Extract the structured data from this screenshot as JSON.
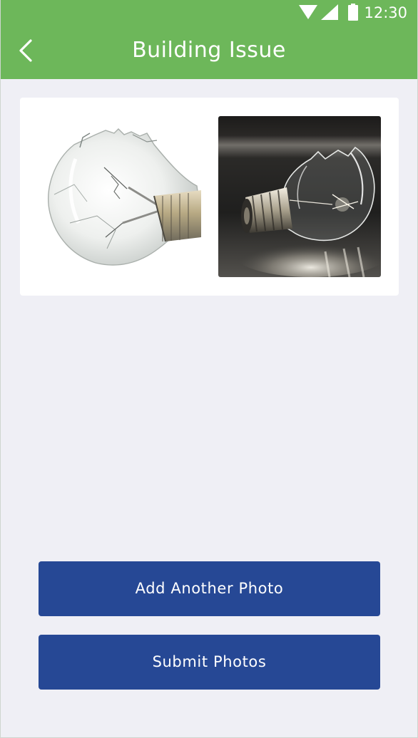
{
  "status_bar": {
    "time": "12:30",
    "icons": [
      "wifi-icon",
      "cell-signal-icon",
      "battery-icon"
    ]
  },
  "header": {
    "back_icon": "chevron-left-icon",
    "title": "Building Issue"
  },
  "photos": [
    {
      "subject": "broken light bulb on white background"
    },
    {
      "subject": "broken light bulb on dark background"
    }
  ],
  "actions": {
    "add_label": "Add Another Photo",
    "submit_label": "Submit Photos"
  },
  "colors": {
    "header_bg": "#6db75a",
    "screen_bg": "#efeff5",
    "button_bg": "#264895",
    "card_bg": "#ffffff"
  }
}
